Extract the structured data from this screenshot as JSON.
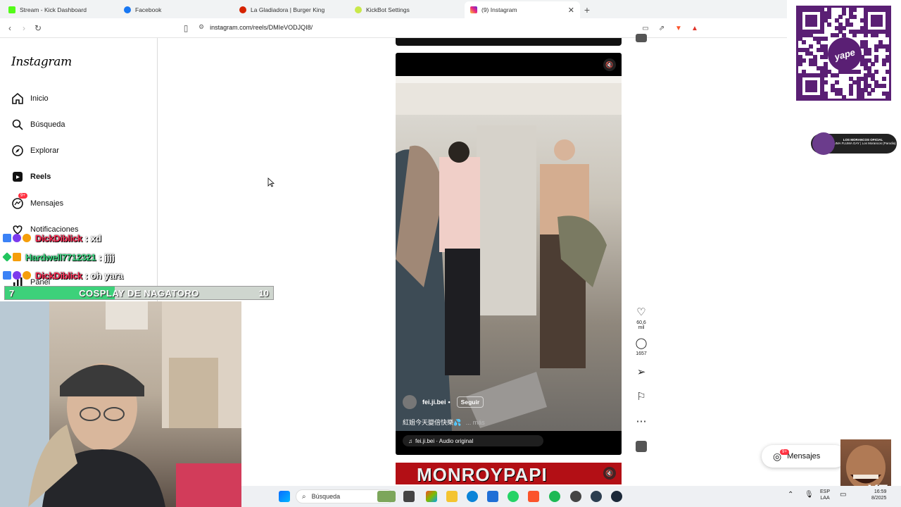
{
  "browser": {
    "tabs": [
      {
        "label": "Stream - Kick Dashboard",
        "icon": "kick-icon",
        "color": "#53fc18",
        "active": false
      },
      {
        "label": "Facebook",
        "icon": "facebook-icon",
        "color": "#1877f2",
        "active": false
      },
      {
        "label": "La Gladiadora | Burger King",
        "icon": "burger-king-icon",
        "color": "#d62300",
        "active": false
      },
      {
        "label": "KickBot Settings",
        "icon": "kickbot-icon",
        "color": "#c9e84a",
        "active": false
      },
      {
        "label": "(9) Instagram",
        "icon": "instagram-icon",
        "color": "#e1306c",
        "active": true
      }
    ],
    "url": "instagram.com/reels/DMIeVODJQI8/"
  },
  "sidebar": {
    "logo": "Instagram",
    "items": [
      {
        "label": "Inicio",
        "icon": "home-icon"
      },
      {
        "label": "Búsqueda",
        "icon": "search-icon"
      },
      {
        "label": "Explorar",
        "icon": "compass-icon"
      },
      {
        "label": "Reels",
        "icon": "reels-icon"
      },
      {
        "label": "Mensajes",
        "icon": "messenger-icon",
        "badge": "9+"
      },
      {
        "label": "Notificaciones",
        "icon": "heart-icon"
      },
      {
        "label": "Panel",
        "icon": "dashboard-icon"
      }
    ]
  },
  "chat": [
    {
      "user": "DickDiblick",
      "message": ": xd",
      "color": "#ff2d55"
    },
    {
      "user": "Hardwell7712321",
      "message": ": jjjj",
      "color": "#3ddc84"
    },
    {
      "user": "DickDiblick",
      "message": ": oh yara",
      "color": "#ff2d55"
    }
  ],
  "poll": {
    "left": "7",
    "label": "COSPLAY DE NAGATORO",
    "right": "10",
    "progress": 0.41
  },
  "reel": {
    "author": "fei.ji.bei",
    "follow": "Seguir",
    "caption": "紅姐今天變倍快樂💦",
    "more": "... más",
    "audio": "fei.ji.bei · Audio original",
    "likes": "60,6 mil",
    "comments": "1657"
  },
  "next_reel_text": "MONROYPAPI",
  "banner_text": "LOS MORANCOS OFICIAL",
  "banner_sub": "FLUMA FLUMA GAY | Los Morancos (Parodia)",
  "qr_label": "yape",
  "messages_pill": {
    "label": "Mensajes",
    "badge": "9+"
  },
  "overlay_badge": "X7",
  "taskbar": {
    "search": "Búsqueda",
    "lang_top": "ESP",
    "lang_bottom": "LAA",
    "time": "16:59",
    "date": "8/2025"
  }
}
